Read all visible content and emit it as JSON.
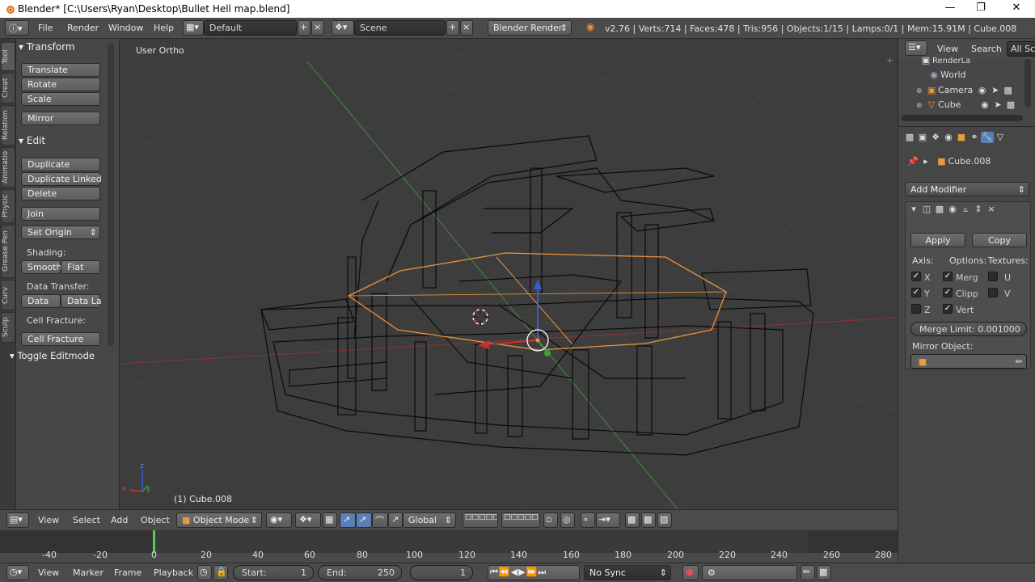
{
  "window": {
    "title": "Blender* [C:\\Users\\Ryan\\Desktop\\Bullet Hell map.blend]"
  },
  "info_header": {
    "menus": [
      "File",
      "Render",
      "Window",
      "Help"
    ],
    "screen_layout": "Default",
    "scene": "Scene",
    "render_engine": "Blender Render",
    "stats": "v2.76 | Verts:714 | Faces:478 | Tris:956 | Objects:1/15 | Lamps:0/1 | Mem:15.91M | Cube.008"
  },
  "tool_tabs": [
    "Tool",
    "Creat",
    "Relation",
    "Animatio",
    "Physic",
    "Grease Pen",
    "Curv",
    "Sculp"
  ],
  "tool_shelf": {
    "transform_header": "Transform",
    "translate": "Translate",
    "rotate": "Rotate",
    "scale": "Scale",
    "mirror": "Mirror",
    "edit_header": "Edit",
    "duplicate": "Duplicate",
    "duplicate_linked": "Duplicate Linked",
    "delete": "Delete",
    "join": "Join",
    "set_origin": "Set Origin",
    "shading_label": "Shading:",
    "smooth": "Smooth",
    "flat": "Flat",
    "data_transfer_label": "Data Transfer:",
    "data": "Data",
    "data_layers": "Data La",
    "cell_fracture_label": "Cell Fracture:",
    "cell_fracture": "Cell Fracture",
    "toggle_editmode": "Toggle Editmode"
  },
  "viewport": {
    "view_label": "User Ortho",
    "object_label": "(1) Cube.008",
    "axis_x": "x",
    "axis_y": "y",
    "axis_z": "z"
  },
  "outliner": {
    "menus": [
      "View",
      "Search"
    ],
    "filter": "All Sc",
    "items": [
      {
        "label": "RenderLa",
        "icon": "render-layers-icon"
      },
      {
        "label": "World",
        "icon": "world-icon"
      },
      {
        "label": "Camera",
        "icon": "camera-icon"
      },
      {
        "label": "Cube",
        "icon": "mesh-icon"
      }
    ]
  },
  "properties": {
    "object_name": "Cube.008",
    "add_modifier": "Add Modifier",
    "apply": "Apply",
    "copy": "Copy",
    "axis_label": "Axis:",
    "options_label": "Options:",
    "textures_label": "Textures:",
    "axis_x": "X",
    "axis_y": "Y",
    "axis_z": "Z",
    "merge": "Merg",
    "clipping": "Clipp",
    "vertex": "Vert",
    "tex_u": "U",
    "tex_v": "V",
    "merge_limit": "Merge Limit:  0.001000",
    "mirror_object_label": "Mirror Object:"
  },
  "viewport_header": {
    "menus": [
      "View",
      "Select",
      "Add",
      "Object"
    ],
    "mode": "Object Mode",
    "orientation": "Global"
  },
  "timeline": {
    "ticks": [
      "-40",
      "-20",
      "0",
      "20",
      "40",
      "60",
      "80",
      "100",
      "120",
      "140",
      "160",
      "180",
      "200",
      "220",
      "240",
      "260",
      "280"
    ],
    "current_frame_marker": "0"
  },
  "timeline_header": {
    "menus": [
      "View",
      "Marker",
      "Frame",
      "Playback"
    ],
    "start_label": "Start:",
    "start_value": "1",
    "end_label": "End:",
    "end_value": "250",
    "current_frame": "1",
    "sync": "No Sync"
  },
  "colors": {
    "selection_outline": "#e8923a",
    "axis_red": "#c83232",
    "axis_green": "#3ca03c",
    "axis_blue": "#2f5fd8",
    "wire": "#0a0a0a"
  }
}
